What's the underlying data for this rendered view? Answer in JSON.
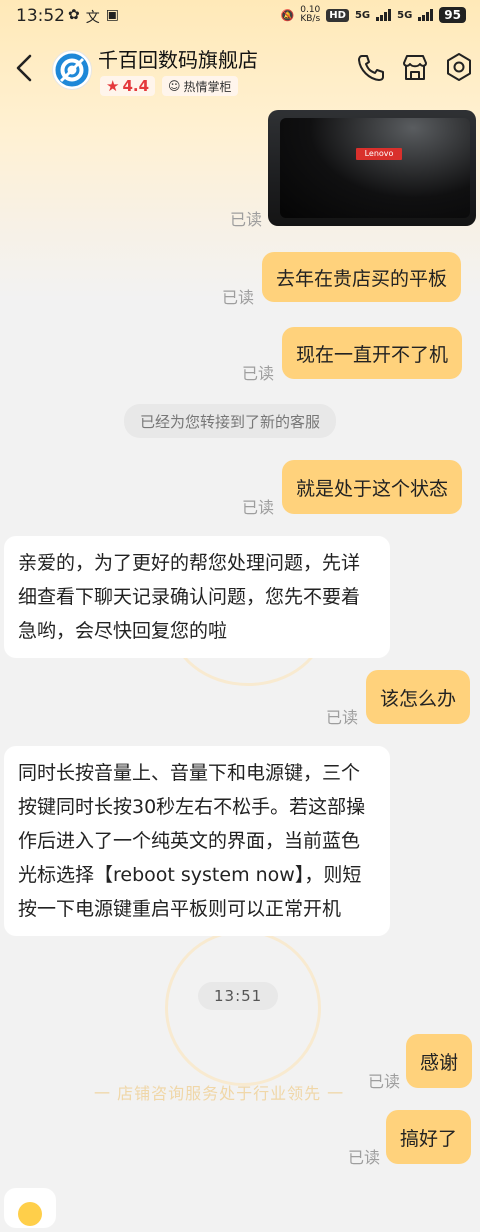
{
  "status_bar": {
    "time": "13:52",
    "net_speed_value": "0.10",
    "net_speed_unit": "KB/s",
    "hd_label": "HD",
    "signal_1": "5G",
    "signal_2": "5G",
    "battery": "95"
  },
  "header": {
    "shop_name": "千百回数码旗舰店",
    "rating": "4.4",
    "badge": "热情掌柜"
  },
  "image_msg": {
    "logo_text": "Lenovo",
    "read": "已读"
  },
  "messages": {
    "m1": {
      "text": "去年在贵店买的平板",
      "read": "已读"
    },
    "m2": {
      "text": "现在一直开不了机",
      "read": "已读"
    },
    "system": "已经为您转接到了新的客服",
    "m3": {
      "text": "就是处于这个状态",
      "read": "已读"
    },
    "r1": "亲爱的，为了更好的帮您处理问题，先详细查看下聊天记录确认问题，您先不要着急哟，会尽快回复您的啦",
    "m4": {
      "text": "该怎么办",
      "read": "已读"
    },
    "r2": "同时长按音量上、音量下和电源键，三个按键同时长按30秒左右不松手。若这部操作后进入了一个纯英文的界面，当前蓝色光标选择【reboot system now】，则短按一下电源键重启平板则可以正常开机",
    "time": "13:51",
    "m5": {
      "text": "感谢",
      "read": "已读"
    },
    "m6": {
      "text": "搞好了",
      "read": "已读"
    }
  },
  "watermark": "一 店铺咨询服务处于行业领先 一",
  "colors": {
    "outgoing": "#ffd27c",
    "rating": "#e4393c",
    "background": "#f2f2f2"
  }
}
